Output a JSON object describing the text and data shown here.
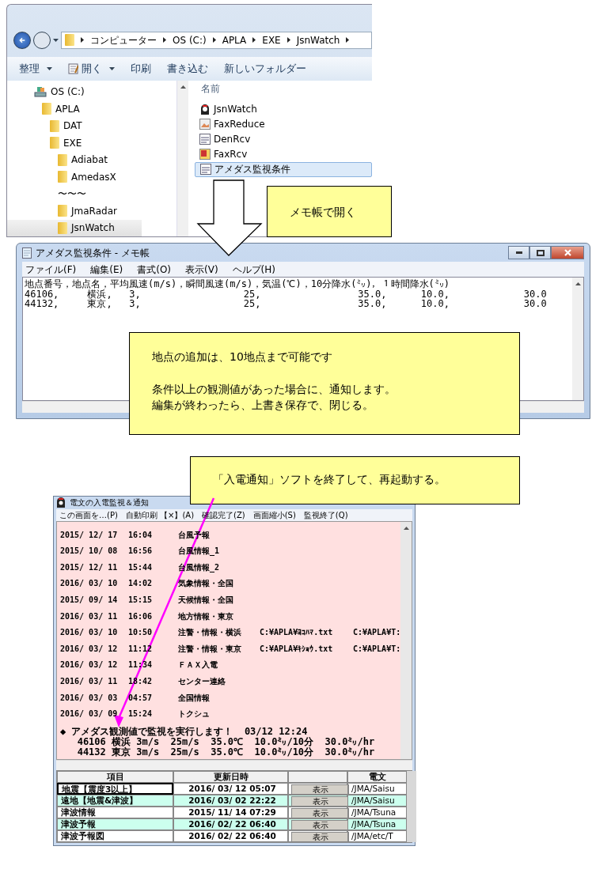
{
  "explorer": {
    "address_path": [
      "コンピューター",
      "OS (C:)",
      "APLA",
      "EXE",
      "JsnWatch"
    ],
    "toolbar": [
      {
        "label": "整理",
        "kind": "menu"
      },
      {
        "label": "開く",
        "kind": "app-menu"
      },
      {
        "label": "印刷",
        "kind": "command"
      },
      {
        "label": "書き込む",
        "kind": "command"
      },
      {
        "label": "新しいフォルダー",
        "kind": "command"
      }
    ],
    "tree": [
      {
        "label": "OS (C:)",
        "kind": "drive",
        "selected": false,
        "children": [
          {
            "label": "APLA",
            "kind": "folder",
            "selected": false,
            "children": [
              {
                "label": "DAT",
                "kind": "folder",
                "selected": false
              },
              {
                "label": "EXE",
                "kind": "folder",
                "selected": false,
                "children": [
                  {
                    "label": "Adiabat",
                    "kind": "folder",
                    "selected": false
                  },
                  {
                    "label": "AmedasX",
                    "kind": "folder",
                    "selected": false
                  },
                  {
                    "label": "〜〜〜",
                    "kind": "gap"
                  },
                  {
                    "label": "JmaRadar",
                    "kind": "folder",
                    "selected": false
                  },
                  {
                    "label": "JsnWatch",
                    "kind": "folder",
                    "selected": true
                  }
                ]
              }
            ]
          }
        ]
      }
    ],
    "files_column": "名前",
    "files": [
      {
        "name": "JsnWatch",
        "kind": "app",
        "selected": false
      },
      {
        "name": "FaxReduce",
        "kind": "image",
        "selected": false
      },
      {
        "name": "DenRcv",
        "kind": "text",
        "selected": false
      },
      {
        "name": "FaxRcv",
        "kind": "fax",
        "selected": false
      },
      {
        "name": "アメダス監視条件",
        "kind": "text",
        "selected": true
      }
    ]
  },
  "callouts": [
    {
      "paragraphs": [
        [
          "メモ帳で開く"
        ]
      ]
    },
    {
      "paragraphs": [
        [
          "地点の追加は、10地点まで可能です"
        ],
        [
          "条件以上の観測値があった場合に、通知します。",
          "編集が終わったら、上書き保存で、閉じる。"
        ]
      ]
    },
    {
      "paragraphs": [
        [
          "「入電通知」ソフトを終了して、再起動する。"
        ]
      ]
    }
  ],
  "notepad": {
    "title": "アメダス監視条件 - メモ帳",
    "menu": [
      "ファイル(F)",
      "編集(E)",
      "書式(O)",
      "表示(V)",
      "ヘルプ(H)"
    ],
    "lines": [
      "地点番号，地点名，平均風速(m/s)，瞬間風速(m/s)，気温(℃)，10分降水(㍉)，１時間降水(㍉)",
      "46106,     横浜,   3,                  25,                 35.0,      10.0,             30.0",
      "44132,     東京,   3,                  25,                 35.0,      10.0,             30.0"
    ]
  },
  "app": {
    "title": "電文の入電監視＆通知",
    "menu": [
      "この画面を…(P)",
      "自動印刷 【×】(A)",
      "確認完了(Z)",
      "画面縮小(S)",
      "監視終了(Q)"
    ],
    "log": [
      {
        "date": "2015/ 12/ 17",
        "time": "16:04",
        "title": "台風予報"
      },
      {
        "date": "2015/ 10/ 08",
        "time": "16:56",
        "title": "台風情報_1"
      },
      {
        "date": "2015/ 12/ 11",
        "time": "15:44",
        "title": "台風情報_2"
      },
      {
        "date": "2016/ 03/ 10",
        "time": "14:02",
        "title": "気象情報・全国"
      },
      {
        "date": "2015/ 09/ 14",
        "time": "15:15",
        "title": "天候情報・全国"
      },
      {
        "date": "2016/ 03/ 11",
        "time": "16:06",
        "title": "地方情報・東京"
      },
      {
        "date": "2016/ 03/ 10",
        "time": "10:50",
        "title": "注警・情報・横浜",
        "file": "C:¥APLA¥ﾖｺﾊﾏ.txt",
        "file_2": "C:¥APLA¥T:"
      },
      {
        "date": "2016/ 03/ 12",
        "time": "11:12",
        "title": "注警・情報・東京",
        "file": "C:¥APLA¥ｷｼｮｳ.txt",
        "file_2": "C:¥APLA¥T:"
      },
      {
        "date": "2016/ 03/ 12",
        "time": "11:34",
        "title": "ＦＡＸ入電"
      },
      {
        "date": "2016/ 03/ 11",
        "time": "18:42",
        "title": "センター連絡"
      },
      {
        "date": "2016/ 03/ 03",
        "time": "04:57",
        "title": "全国情報"
      },
      {
        "date": "2016/ 03/ 09",
        "time": "15:24",
        "title": "トクシュ"
      }
    ],
    "notice": [
      "◆ アメダス観測値で監視を実行します！  03/12 12:24",
      "   46106 横浜 3m/s  25m/s  35.0℃  10.0㍉/10分  30.0㍉/hr",
      "   44132 東京 3m/s  25m/s  35.0℃  10.0㍉/10分  30.0㍉/hr"
    ],
    "columns": [
      "項目",
      "更新日時",
      "",
      "電文"
    ],
    "rows": [
      {
        "item": "地震【震度3以上】",
        "updated": "2016/ 03/ 12  05:07",
        "button": "表示",
        "telegram": "/JMA/Saisu",
        "highlighted": false,
        "selected": true
      },
      {
        "item": "遠地【地震&津波】",
        "updated": "2016/ 03/ 02  22:22",
        "button": "表示",
        "telegram": "/JMA/Saisu",
        "highlighted": true,
        "selected": false
      },
      {
        "item": "津波情報",
        "updated": "2015/ 11/ 14  07:29",
        "button": "表示",
        "telegram": "/JMA/Tsuna",
        "highlighted": false,
        "selected": false
      },
      {
        "item": "津波予報",
        "updated": "2016/ 02/ 22  06:40",
        "button": "表示",
        "telegram": "/JMA/Tsuna",
        "highlighted": true,
        "selected": false
      },
      {
        "item": "津波予報図",
        "updated": "2016/ 02/ 22  06:40",
        "button": "表示",
        "telegram": "/JMA/etc/T",
        "highlighted": false,
        "selected": false
      }
    ]
  }
}
